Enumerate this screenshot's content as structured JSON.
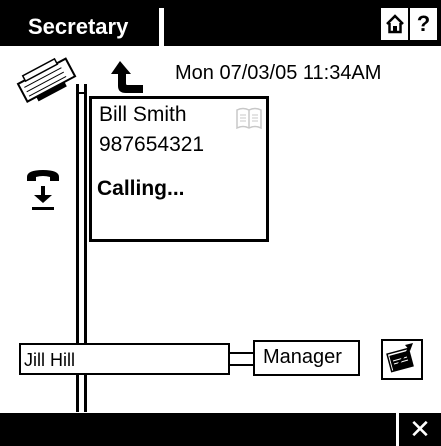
{
  "header": {
    "title": "Secretary",
    "home_icon": "home-icon",
    "help_label": "?"
  },
  "status": {
    "datetime": "Mon 07/03/05 11:34AM"
  },
  "caller": {
    "name": "Bill Smith",
    "number": "987654321",
    "status": "Calling...",
    "book_icon": "address-book-icon"
  },
  "icons": {
    "fax": "fax-icon",
    "transfer": "transfer-arrow-icon",
    "hold": "handset-hold-icon",
    "write": "write-note-icon"
  },
  "boxes": {
    "left_label": "Jill Hill",
    "right_label": "Manager"
  },
  "footer": {
    "close_label": "✕"
  },
  "colors": {
    "bar": "#000000",
    "background": "#ffffff",
    "book_icon": "#c8c8c8"
  }
}
